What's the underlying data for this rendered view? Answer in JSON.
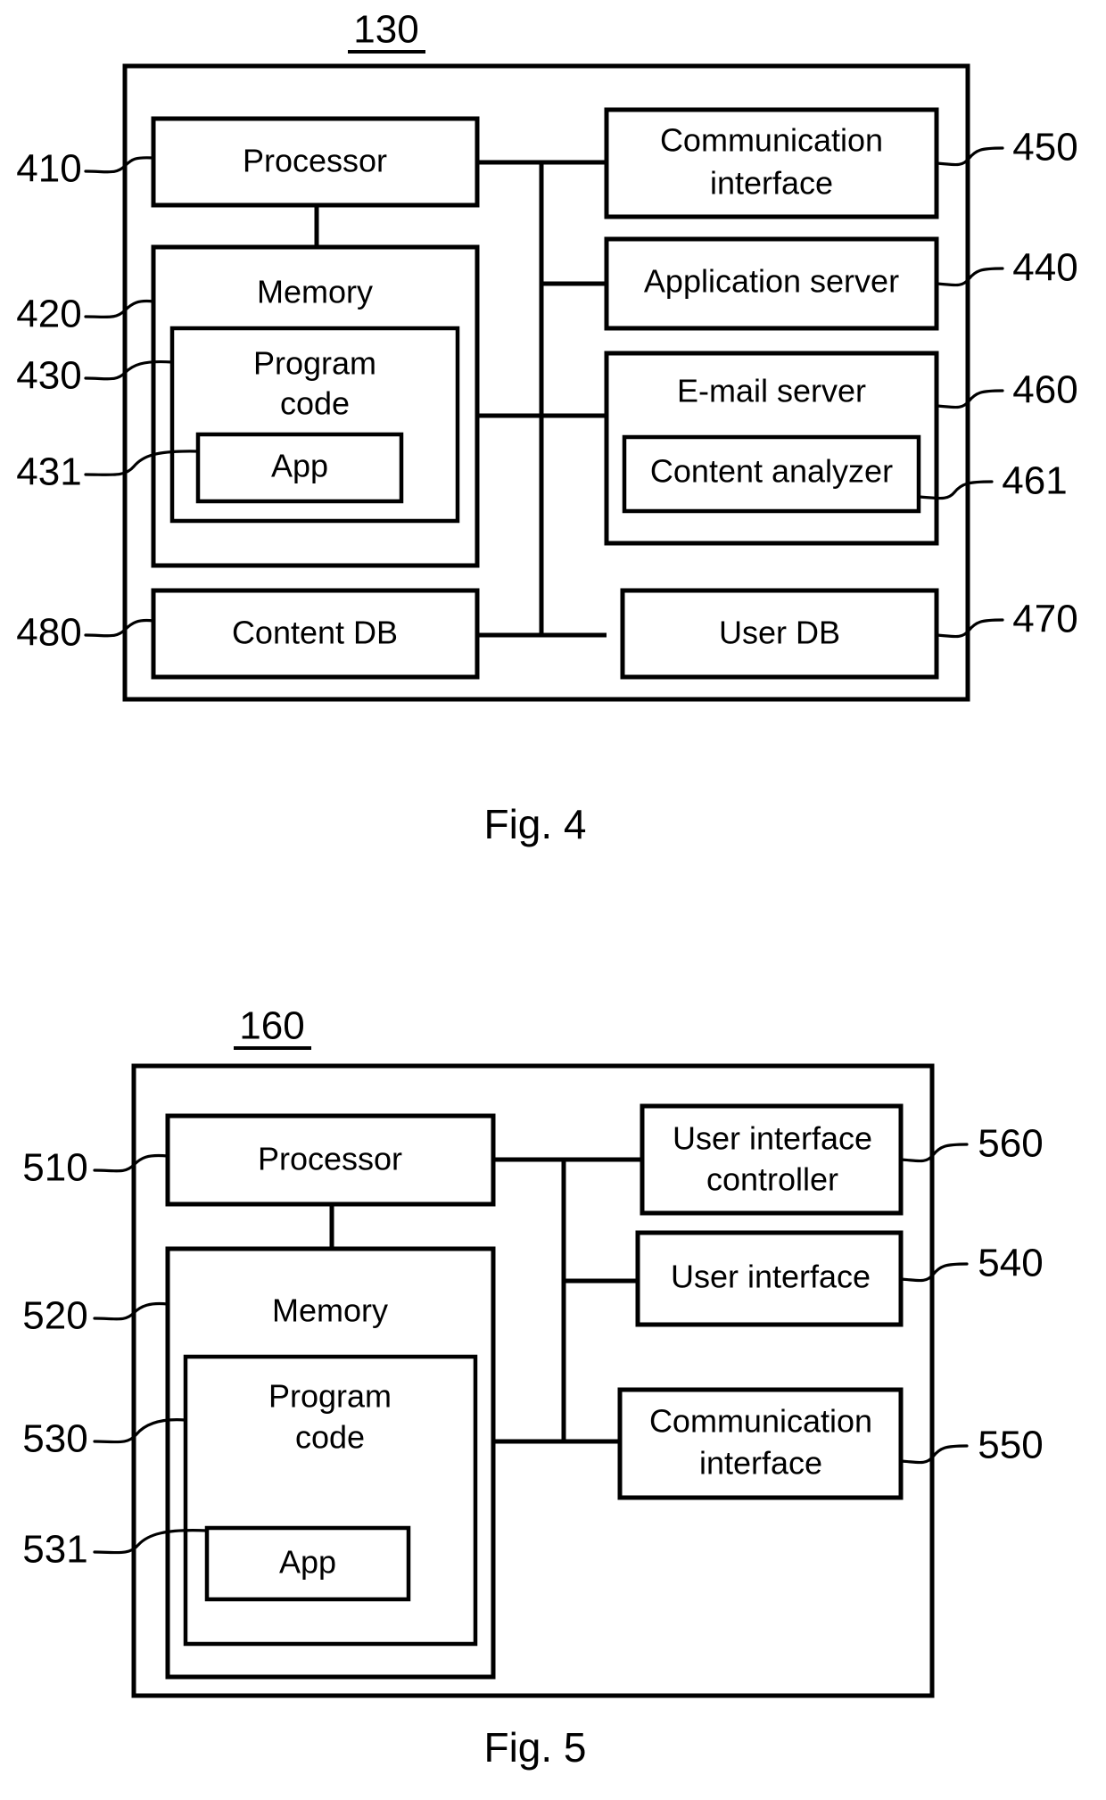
{
  "document": {
    "type": "patent-figure-sheet",
    "figures": [
      {
        "id": "fig4",
        "caption": "Fig. 4",
        "title_ref": "130",
        "blocks": [
          {
            "key": "processor",
            "label": "Processor",
            "ref": "410",
            "ref_side": "left"
          },
          {
            "key": "memory",
            "label": "Memory",
            "ref": "420",
            "ref_side": "left"
          },
          {
            "key": "program_code",
            "label": "Program\ncode",
            "ref": "430",
            "ref_side": "left"
          },
          {
            "key": "app",
            "label": "App",
            "ref": "431",
            "ref_side": "left"
          },
          {
            "key": "content_db",
            "label": "Content DB",
            "ref": "480",
            "ref_side": "left"
          },
          {
            "key": "comm_interface",
            "label": "Communication\ninterface",
            "ref": "450",
            "ref_side": "right"
          },
          {
            "key": "app_server",
            "label": "Application server",
            "ref": "440",
            "ref_side": "right"
          },
          {
            "key": "email_server",
            "label": "E-mail server",
            "ref": "460",
            "ref_side": "right"
          },
          {
            "key": "content_analyzer",
            "label": "Content analyzer",
            "ref": "461",
            "ref_side": "right"
          },
          {
            "key": "user_db",
            "label": "User DB",
            "ref": "470",
            "ref_side": "right"
          }
        ],
        "labels": {
          "processor": "Processor",
          "memory": "Memory",
          "program_code_line1": "Program",
          "program_code_line2": "code",
          "app": "App",
          "content_db": "Content DB",
          "comm_interface_line1": "Communication",
          "comm_interface_line2": "interface",
          "app_server": "Application server",
          "email_server": "E-mail server",
          "content_analyzer": "Content analyzer",
          "user_db": "User DB"
        },
        "refs": {
          "processor": "410",
          "memory": "420",
          "program_code": "430",
          "app": "431",
          "content_db": "480",
          "comm_interface": "450",
          "app_server": "440",
          "email_server": "460",
          "content_analyzer": "461",
          "user_db": "470"
        }
      },
      {
        "id": "fig5",
        "caption": "Fig. 5",
        "title_ref": "160",
        "blocks": [
          {
            "key": "processor",
            "label": "Processor",
            "ref": "510",
            "ref_side": "left"
          },
          {
            "key": "memory",
            "label": "Memory",
            "ref": "520",
            "ref_side": "left"
          },
          {
            "key": "program_code",
            "label": "Program\ncode",
            "ref": "530",
            "ref_side": "left"
          },
          {
            "key": "app",
            "label": "App",
            "ref": "531",
            "ref_side": "left"
          },
          {
            "key": "ui_controller",
            "label": "User interface\ncontroller",
            "ref": "560",
            "ref_side": "right"
          },
          {
            "key": "user_interface",
            "label": "User interface",
            "ref": "540",
            "ref_side": "right"
          },
          {
            "key": "comm_interface",
            "label": "Communication\ninterface",
            "ref": "550",
            "ref_side": "right"
          }
        ],
        "labels": {
          "processor": "Processor",
          "memory": "Memory",
          "program_code_line1": "Program",
          "program_code_line2": "code",
          "app": "App",
          "ui_controller_line1": "User interface",
          "ui_controller_line2": "controller",
          "user_interface": "User interface",
          "comm_interface_line1": "Communication",
          "comm_interface_line2": "interface"
        },
        "refs": {
          "processor": "510",
          "memory": "520",
          "program_code": "530",
          "app": "531",
          "ui_controller": "560",
          "user_interface": "540",
          "comm_interface": "550"
        }
      }
    ],
    "colors": {
      "ink": "#000000",
      "paper": "#ffffff"
    }
  }
}
